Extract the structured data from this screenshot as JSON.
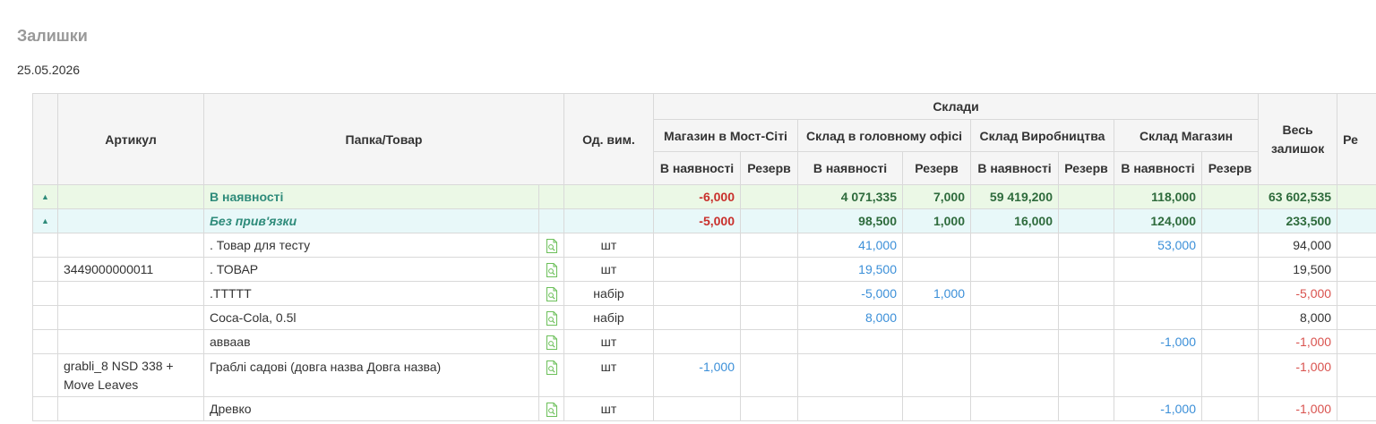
{
  "page": {
    "title": "Залишки",
    "date": "25.05.2026"
  },
  "table": {
    "headers": {
      "article": "Артикул",
      "product": "Папка/Товар",
      "unit": "Од. вим.",
      "warehouses_group": "Склади",
      "total": "Весь залишок",
      "extra_cut": "Ре",
      "warehouses": [
        {
          "name": "Магазин в Мост-Сіті",
          "in_stock": "В наявності",
          "reserve": "Резерв"
        },
        {
          "name": "Склад в головному офісі",
          "in_stock": "В наявності",
          "reserve": "Резерв"
        },
        {
          "name": "Склад Виробництва",
          "in_stock": "В наявності",
          "reserve": "Резерв"
        },
        {
          "name": "Склад Магазин",
          "in_stock": "В наявності",
          "reserve": "Резерв"
        }
      ]
    },
    "groups": [
      {
        "name": "В наявності",
        "expander": "▲",
        "values": [
          "-6,000",
          "",
          "4 071,335",
          "7,000",
          "59 419,200",
          "",
          "118,000",
          "",
          "63 602,535"
        ]
      },
      {
        "name": "Без прив'язки",
        "expander": "▲",
        "values": [
          "-5,000",
          "",
          "98,500",
          "1,000",
          "16,000",
          "",
          "124,000",
          "",
          "233,500"
        ]
      }
    ],
    "rows": [
      {
        "article": "",
        "name": ". Товар для тесту",
        "unit": "шт",
        "values": [
          "",
          "",
          "41,000",
          "",
          "",
          "",
          "53,000",
          "",
          "94,000"
        ]
      },
      {
        "article": "3449000000011",
        "name": ". ТОВАР",
        "unit": "шт",
        "values": [
          "",
          "",
          "19,500",
          "",
          "",
          "",
          "",
          "",
          "19,500"
        ]
      },
      {
        "article": "",
        "name": ".ТТТТТ",
        "unit": "набір",
        "values": [
          "",
          "",
          "-5,000",
          "1,000",
          "",
          "",
          "",
          "",
          "-5,000"
        ]
      },
      {
        "article": "",
        "name": "Coca-Cola, 0.5l",
        "unit": "набір",
        "values": [
          "",
          "",
          "8,000",
          "",
          "",
          "",
          "",
          "",
          "8,000"
        ]
      },
      {
        "article": "",
        "name": "авваав",
        "unit": "шт",
        "values": [
          "",
          "",
          "",
          "",
          "",
          "",
          "-1,000",
          "",
          "-1,000"
        ]
      },
      {
        "article": "grabli_8 NSD 338 + Move Leaves",
        "name": "Граблі садові (довга назва Довга назва)",
        "unit": "шт",
        "values": [
          "-1,000",
          "",
          "",
          "",
          "",
          "",
          "",
          "",
          "-1,000"
        ]
      },
      {
        "article": "",
        "name": "Древко",
        "unit": "шт",
        "values": [
          "",
          "",
          "",
          "",
          "",
          "",
          "-1,000",
          "",
          "-1,000"
        ]
      }
    ]
  },
  "colors": {
    "group_green_bg": "#ebf8e6",
    "group_cyan_bg": "#e8f8f9",
    "group_text": "#2e8b7a",
    "negative": "#d9534f",
    "link_blue": "#3b8fd8",
    "header_bg": "#f5f5f5"
  },
  "icons": {
    "product_card": "document-search-icon",
    "expander": "triangle-up-icon"
  }
}
